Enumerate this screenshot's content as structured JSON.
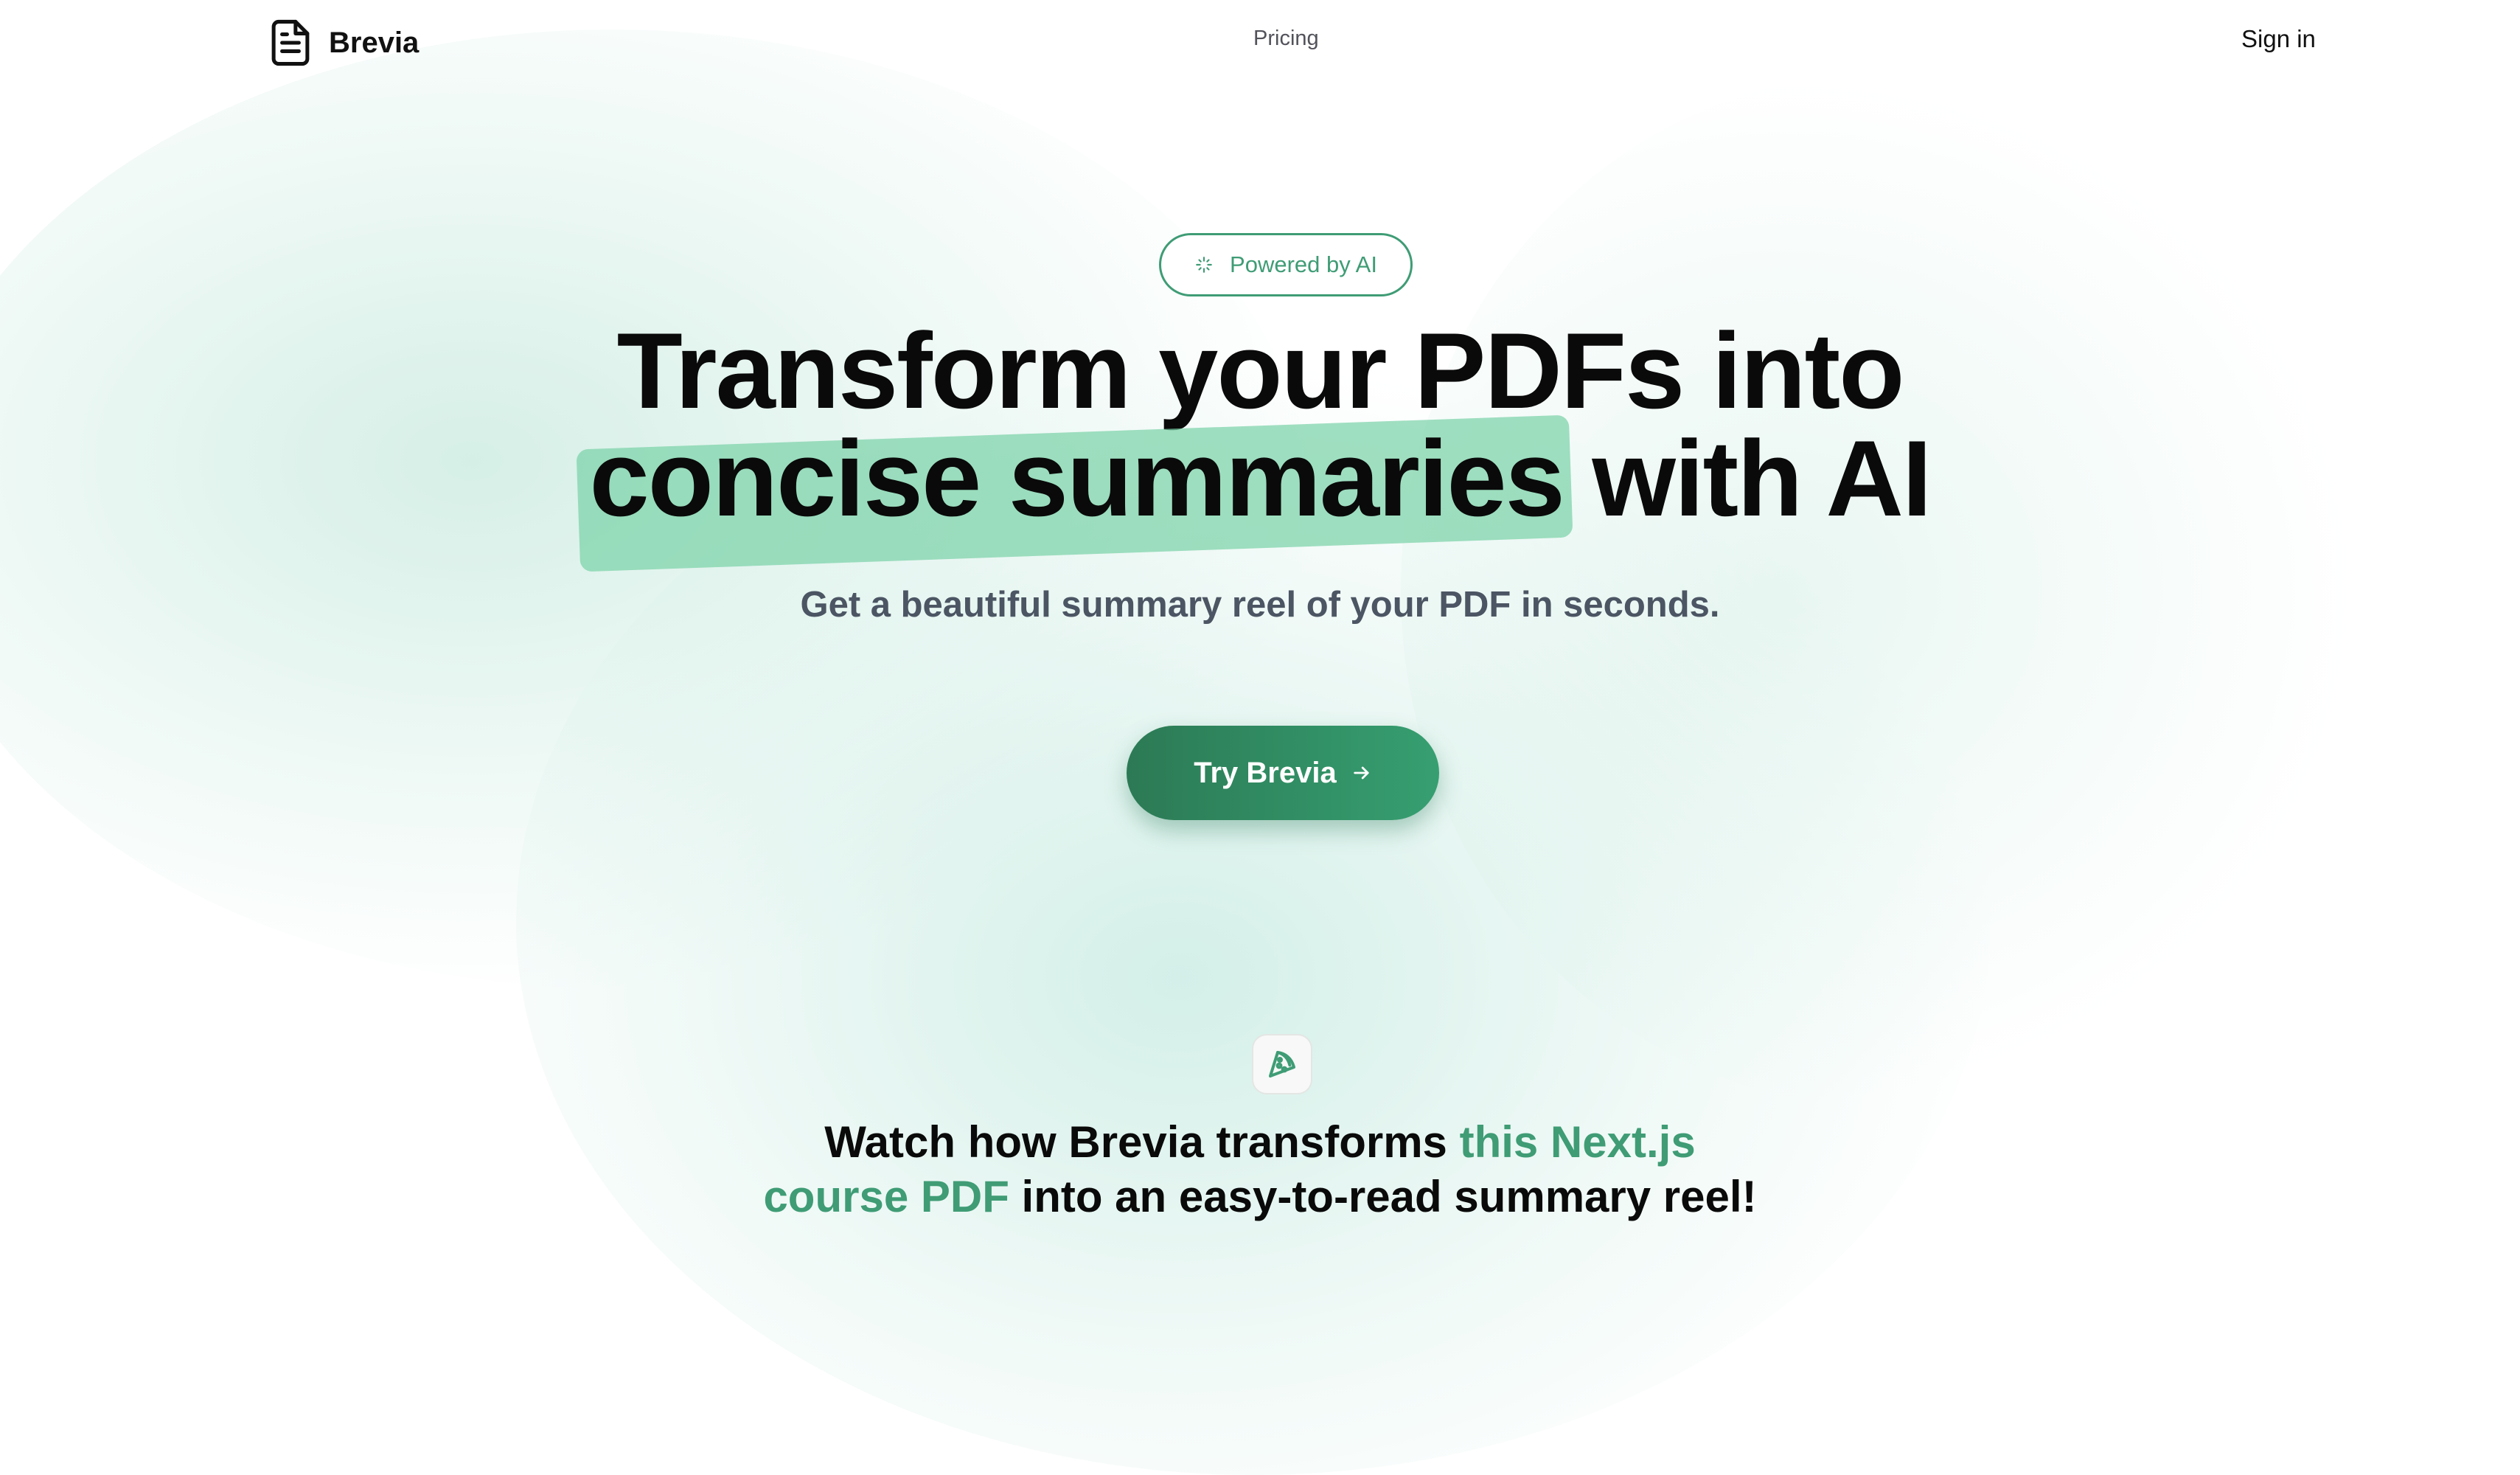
{
  "colors": {
    "accent": "#3f9c75",
    "highlight": "#78d1a7",
    "cta_start": "#2c7a55",
    "cta_end": "#369f71",
    "subtitle": "#4b5563"
  },
  "nav": {
    "brand_name": "Brevia",
    "brand_icon": "file-text-icon",
    "pricing_label": "Pricing",
    "signin_label": "Sign in"
  },
  "hero": {
    "badge_icon": "sparkles-icon",
    "badge_label": "Powered by AI",
    "headline_line1": "Transform your PDFs into",
    "headline_highlight": "concise summaries",
    "headline_rest": "with AI",
    "subtitle": "Get a beautiful summary reel of your PDF in seconds.",
    "cta_label": "Try Brevia",
    "cta_icon": "arrow-right-icon"
  },
  "demo": {
    "icon": "pizza-icon",
    "heading_part1": "Watch how Brevia transforms",
    "heading_accent1": "this Next.js",
    "heading_accent2": "course PDF",
    "heading_part2": "into an easy-to-read summary reel!"
  }
}
